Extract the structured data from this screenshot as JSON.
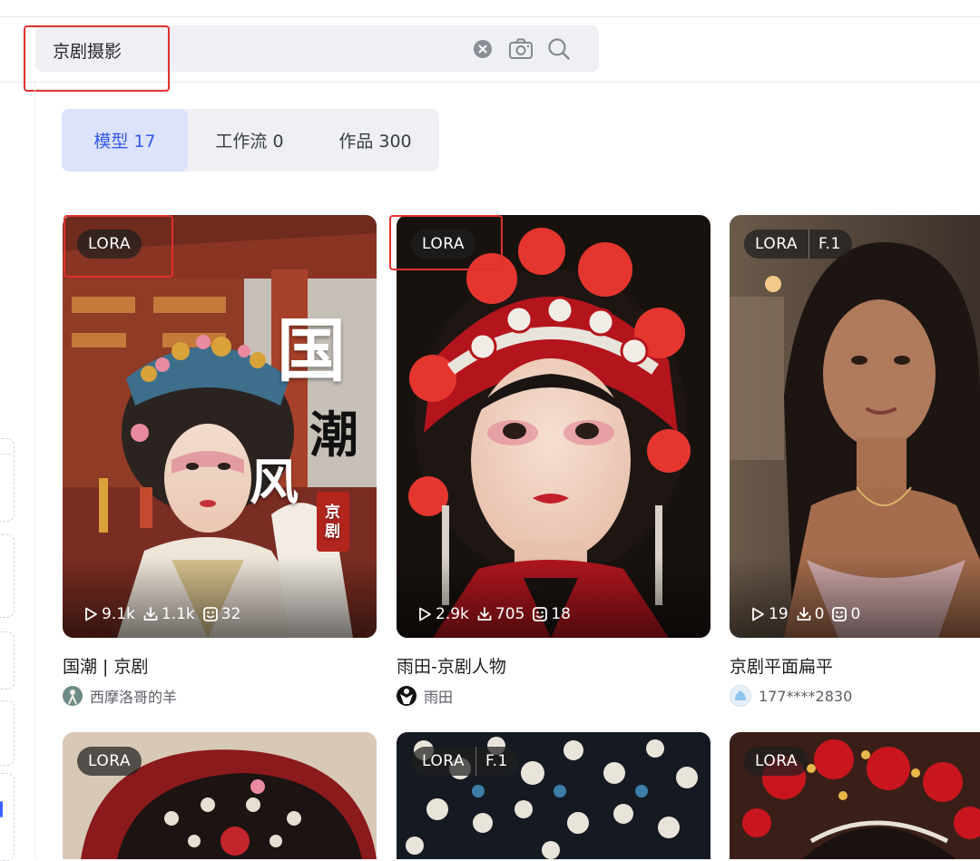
{
  "search": {
    "query": "京剧摄影"
  },
  "icons": {
    "clear": "clear-icon",
    "camera": "camera-icon",
    "search": "search-icon"
  },
  "tabs": [
    {
      "label": "模型 17",
      "active": true
    },
    {
      "label": "工作流 0",
      "active": false
    },
    {
      "label": "作品 300",
      "active": false
    }
  ],
  "cards": [
    {
      "badges": [
        "LORA"
      ],
      "stats": {
        "runs": "9.1k",
        "downloads": "1.1k",
        "works": "32"
      },
      "title": "国潮 | 京剧",
      "author": "西摩洛哥的羊",
      "overlay": {
        "line1": "国",
        "line2": "潮",
        "line3": "风",
        "seal": "京剧"
      }
    },
    {
      "badges": [
        "LORA"
      ],
      "stats": {
        "runs": "2.9k",
        "downloads": "705",
        "works": "18"
      },
      "title": "雨田-京剧人物",
      "author": "雨田"
    },
    {
      "badges": [
        "LORA",
        "F.1"
      ],
      "stats": {
        "runs": "19",
        "downloads": "0",
        "works": "0"
      },
      "title": "京剧平面扁平",
      "author": "177****2830"
    },
    {
      "badges": [
        "LORA"
      ]
    },
    {
      "badges": [
        "LORA",
        "F.1"
      ]
    },
    {
      "badges": [
        "LORA"
      ]
    }
  ],
  "colors": {
    "accent": "#3558f0",
    "annotation": "#e0312d",
    "tab_bg": "#eef0f4",
    "tab_active_bg": "#dde3fb"
  }
}
